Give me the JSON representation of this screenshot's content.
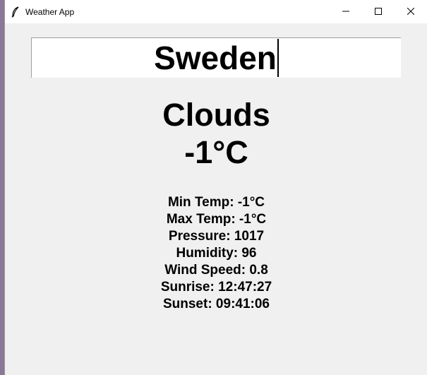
{
  "window": {
    "title": "Weather App",
    "controls": {
      "minimize_icon": "minimize-icon",
      "maximize_icon": "maximize-icon",
      "close_icon": "close-icon"
    }
  },
  "search": {
    "value": "Sweden"
  },
  "weather": {
    "condition": "Clouds",
    "temperature": "-1°C",
    "details": [
      "Min Temp: -1°C",
      "Max Temp: -1°C",
      "Pressure: 1017",
      "Humidity: 96",
      "Wind Speed: 0.8",
      "Sunrise: 12:47:27",
      "Sunset: 09:41:06"
    ]
  },
  "colors": {
    "background": "#f0f0f0",
    "titlebar": "#ffffff",
    "text": "#000000"
  }
}
